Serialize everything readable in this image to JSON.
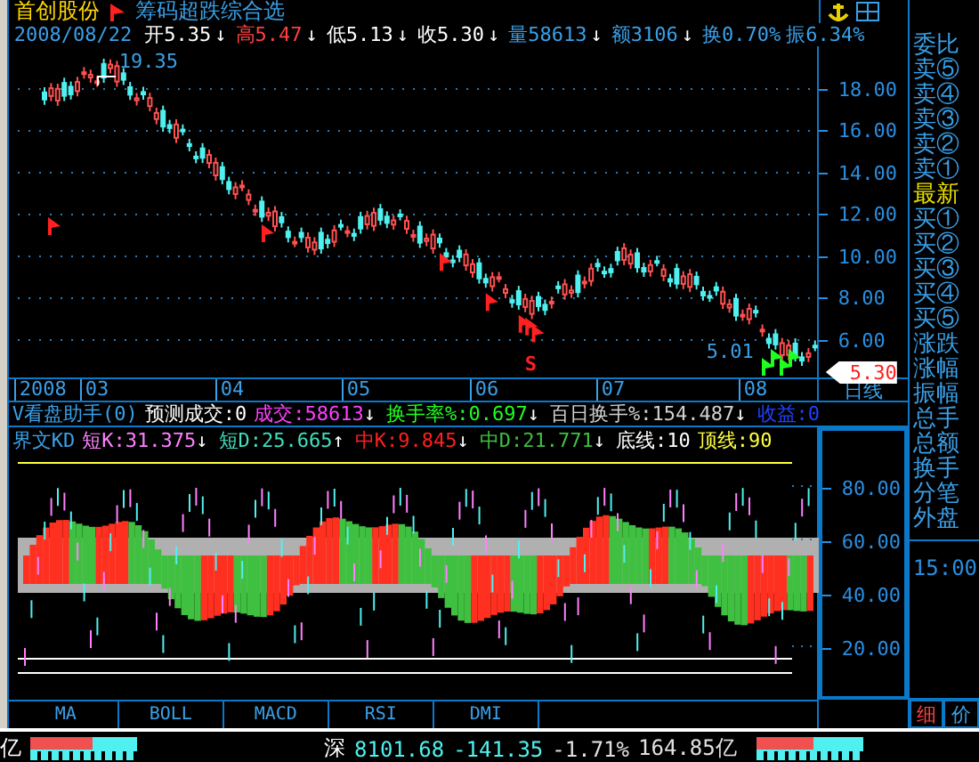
{
  "header": {
    "stock_name": "首创股份",
    "formula": "筹码超跌综合选",
    "date": "2008/08/22",
    "quotes": [
      {
        "text": "开5.35",
        "arrow": "↓",
        "color": "#ffffff"
      },
      {
        "text": "高5.47",
        "arrow": "↓",
        "color": "#ff4040"
      },
      {
        "text": "低5.13",
        "arrow": "↓",
        "color": "#ffffff"
      },
      {
        "text": "收5.30",
        "arrow": "↓",
        "color": "#ffffff"
      },
      {
        "text": "量58613",
        "arrow": "↓",
        "color": "#3aa0e8"
      },
      {
        "text": "额3106",
        "arrow": "↓",
        "color": "#3aa0e8"
      },
      {
        "text": "换0.70%",
        "color": "#3aa0e8"
      },
      {
        "text": "振6.34%",
        "color": "#3aa0e8"
      }
    ]
  },
  "price_chart": {
    "high_label": "19.35",
    "low_label": "5.01",
    "signal": "S",
    "yticks": [
      "18.00",
      "16.00",
      "14.00",
      "12.00",
      "10.00",
      "8.00",
      "6.00"
    ],
    "last_price": "5.30"
  },
  "date_axis": {
    "labels": [
      "2008",
      "03",
      "04",
      "05",
      "06",
      "07",
      "08"
    ],
    "period": "日线"
  },
  "indicator_header": [
    {
      "items": [
        {
          "text": "V看盘助手(0)",
          "color": "#3aa0e8"
        },
        {
          "text": "预测成交:0",
          "color": "#ffffff"
        },
        {
          "text": "成交:58613",
          "arrow": "↓",
          "color": "#ff40ff"
        },
        {
          "text": "换手率%:0.697",
          "arrow": "↓",
          "color": "#20ff20"
        },
        {
          "text": "百日换手%:154.487",
          "arrow": "↓",
          "color": "#d0d0d0"
        },
        {
          "text": "收益:0",
          "color": "#2040ff"
        }
      ]
    },
    {
      "items": [
        {
          "text": "界文KD",
          "color": "#3aa0e8"
        },
        {
          "text": "短K:31.375",
          "arrow": "↓",
          "color": "#ff80ff"
        },
        {
          "text": "短D:25.665",
          "arrow": "↑",
          "color": "#40e0c0"
        },
        {
          "text": "中K:9.845",
          "arrow": "↓",
          "color": "#ff2020"
        },
        {
          "text": "中D:21.771",
          "arrow": "↓",
          "color": "#40c040"
        },
        {
          "text": "底线:10",
          "color": "#ffffff"
        },
        {
          "text": "顶线:90",
          "color": "#ffff40"
        }
      ]
    }
  ],
  "indicator_chart": {
    "yticks": [
      "80.00",
      "60.00",
      "40.00",
      "20.00"
    ]
  },
  "tabs": [
    {
      "label": "MA",
      "selected": false
    },
    {
      "label": "BOLL",
      "selected": false
    },
    {
      "label": "MACD",
      "selected": false
    },
    {
      "label": "RSI",
      "selected": false
    },
    {
      "label": "DMI",
      "selected": false
    }
  ],
  "quote_panel": {
    "items": [
      {
        "label": "委比",
        "color": "#3aa0e8"
      },
      {
        "label": "卖⑤",
        "color": "#3aa0e8"
      },
      {
        "label": "卖④",
        "color": "#3aa0e8"
      },
      {
        "label": "卖③",
        "color": "#3aa0e8"
      },
      {
        "label": "卖②",
        "color": "#3aa0e8"
      },
      {
        "label": "卖①",
        "color": "#3aa0e8"
      },
      {
        "label": "最新",
        "color": "#e8e000"
      },
      {
        "label": "买①",
        "color": "#3aa0e8"
      },
      {
        "label": "买②",
        "color": "#3aa0e8"
      },
      {
        "label": "买③",
        "color": "#3aa0e8"
      },
      {
        "label": "买④",
        "color": "#3aa0e8"
      },
      {
        "label": "买⑤",
        "color": "#3aa0e8"
      },
      {
        "label": "涨跌",
        "color": "#3aa0e8"
      },
      {
        "label": "涨幅",
        "color": "#3aa0e8"
      },
      {
        "label": "振幅",
        "color": "#3aa0e8"
      },
      {
        "label": "总手",
        "color": "#3aa0e8"
      },
      {
        "label": "总额",
        "color": "#3aa0e8"
      },
      {
        "label": "换手",
        "color": "#3aa0e8"
      },
      {
        "label": "分笔",
        "color": "#3aa0e8"
      },
      {
        "label": "外盘",
        "color": "#3aa0e8"
      }
    ],
    "time": "15:00",
    "tabs": [
      {
        "label": "细",
        "selected": true
      },
      {
        "label": "价",
        "selected": false
      }
    ]
  },
  "status_bar": {
    "left_fragment": "亿",
    "left_meter": {
      "level": 0.58
    },
    "market": "深",
    "index": "8101.68",
    "change": "-141.35",
    "percent": "-1.71%",
    "turnover": "164.85亿",
    "right_meter": {
      "level": 0.53
    }
  }
}
